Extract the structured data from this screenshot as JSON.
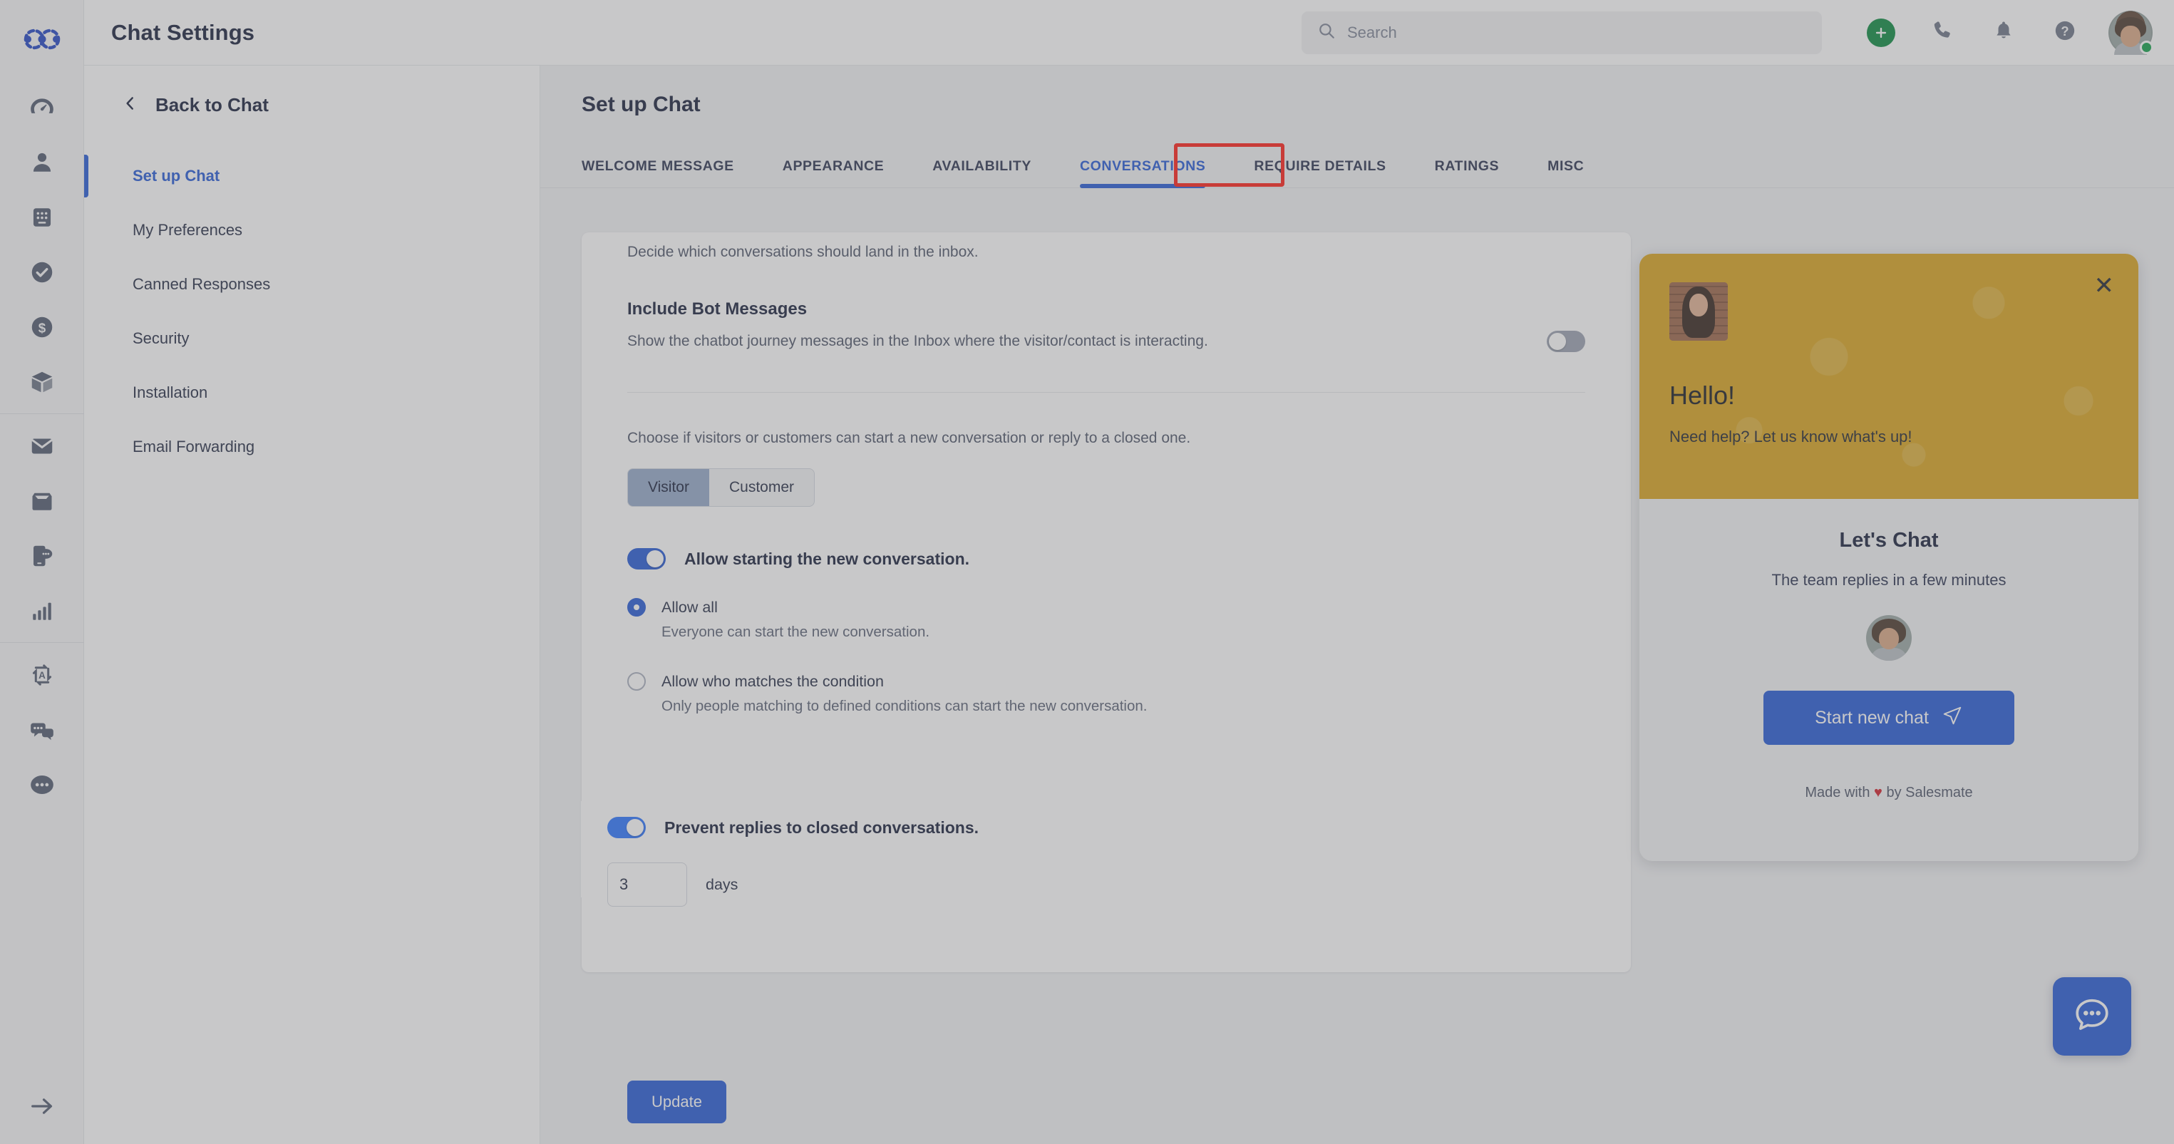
{
  "app": {
    "logo_icon": "salesmate-logo-icon"
  },
  "topbar": {
    "title": "Chat Settings",
    "search": {
      "placeholder": "Search",
      "value": "",
      "icon": "search-icon"
    },
    "actions": [
      {
        "name": "add-new-button",
        "icon": "plus-icon",
        "label": "+"
      },
      {
        "name": "call-button",
        "icon": "phone-icon"
      },
      {
        "name": "notifications-button",
        "icon": "bell-icon"
      },
      {
        "name": "help-button",
        "icon": "question-circle-icon"
      }
    ],
    "avatar": {
      "name": "user-avatar",
      "status": "online"
    }
  },
  "rail": {
    "items": [
      {
        "name": "dashboard",
        "icon": "speedometer-icon"
      },
      {
        "name": "contacts",
        "icon": "person-icon"
      },
      {
        "name": "companies",
        "icon": "building-icon"
      },
      {
        "name": "activities",
        "icon": "check-circle-icon"
      },
      {
        "name": "deals",
        "icon": "dollar-circle-icon"
      },
      {
        "name": "products",
        "icon": "box-icon"
      },
      {
        "name": "email",
        "icon": "envelope-icon"
      },
      {
        "name": "inbox",
        "icon": "inbox-tray-icon"
      },
      {
        "name": "messaging",
        "icon": "mobile-chat-icon"
      },
      {
        "name": "reports",
        "icon": "bar-chart-icon"
      },
      {
        "name": "automation",
        "icon": "automation-a-icon"
      },
      {
        "name": "chat",
        "icon": "chat-bubbles-icon"
      },
      {
        "name": "more",
        "icon": "ellipsis-circle-icon"
      }
    ],
    "expand": {
      "name": "expand-rail",
      "icon": "arrow-right-icon"
    }
  },
  "settings_nav": {
    "back": {
      "label": "Back to Chat",
      "icon": "chevron-left-icon"
    },
    "items": [
      {
        "label": "Set up Chat",
        "active": true
      },
      {
        "label": "My Preferences",
        "active": false
      },
      {
        "label": "Canned Responses",
        "active": false
      },
      {
        "label": "Security",
        "active": false
      },
      {
        "label": "Installation",
        "active": false
      },
      {
        "label": "Email Forwarding",
        "active": false
      }
    ]
  },
  "main": {
    "page_title": "Set up Chat",
    "tabs": [
      {
        "label": "WELCOME MESSAGE",
        "active": false
      },
      {
        "label": "APPEARANCE",
        "active": false
      },
      {
        "label": "AVAILABILITY",
        "active": false
      },
      {
        "label": "CONVERSATIONS",
        "active": true,
        "highlighted": true
      },
      {
        "label": "REQUIRE DETAILS",
        "active": false
      },
      {
        "label": "RATINGS",
        "active": false
      },
      {
        "label": "MISC",
        "active": false
      }
    ],
    "lead_text": "Decide which conversations should land in the inbox.",
    "bot_messages": {
      "title": "Include Bot Messages",
      "description": "Show the chatbot journey messages in the Inbox where the visitor/contact is interacting.",
      "toggle_on": false
    },
    "choose_text": "Choose if visitors or customers can start a new conversation or reply to a closed one.",
    "segment": {
      "options": [
        "Visitor",
        "Customer"
      ],
      "selected": "Visitor"
    },
    "allow_start": {
      "label": "Allow starting the new conversation.",
      "toggle_on": true,
      "radios": [
        {
          "label": "Allow all",
          "sub": "Everyone can start the new conversation.",
          "checked": true
        },
        {
          "label": "Allow who matches the condition",
          "sub": "Only people matching to defined conditions can start the new conversation.",
          "checked": false
        }
      ]
    },
    "prevent_replies": {
      "label": "Prevent replies to closed conversations.",
      "toggle_on": true,
      "days_value": "3",
      "days_label": "days"
    },
    "update_button": "Update"
  },
  "widget": {
    "close_icon": "close-icon",
    "greeting": "Hello!",
    "subtitle": "Need help? Let us know what's up!",
    "body_title": "Let's Chat",
    "body_caption": "The team replies in a few minutes",
    "cta_label": "Start new chat",
    "cta_icon": "send-plane-icon",
    "footer_prefix": "Made with",
    "footer_heart": "♥",
    "footer_suffix": "by Salesmate",
    "launcher_icon": "chat-bubble-dots-icon"
  },
  "colors": {
    "accent_blue": "#2559d6",
    "toggle_bright_blue": "#2b74ff",
    "widget_header_yellow": "#d9a41e",
    "highlight_red": "#ff1d16",
    "status_green": "#11a14a",
    "heart_red": "#d1202a"
  }
}
